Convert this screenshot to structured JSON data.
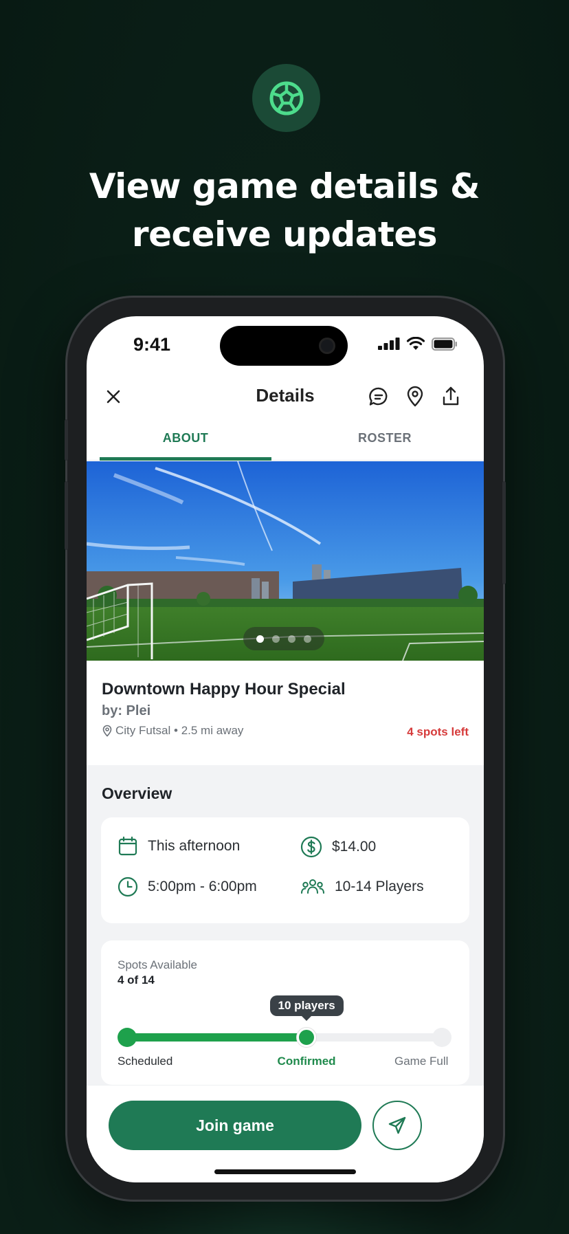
{
  "promo": {
    "headline_line1": "View game details &",
    "headline_line2": "receive updates",
    "badge_icon": "soccer-ball-icon"
  },
  "status_bar": {
    "time": "9:41"
  },
  "nav": {
    "title": "Details",
    "close_icon": "close-icon",
    "actions": [
      "chat-icon",
      "location-pin-icon",
      "share-icon"
    ]
  },
  "tabs": [
    {
      "label": "ABOUT",
      "active": true
    },
    {
      "label": "ROSTER",
      "active": false
    }
  ],
  "carousel": {
    "count": 4,
    "active_index": 0
  },
  "game": {
    "title": "Downtown Happy Hour Special",
    "organizer": "by: Plei",
    "location": "City Futsal • 2.5 mi away",
    "spots_left": "4 spots left"
  },
  "overview": {
    "title": "Overview",
    "date": "This afternoon",
    "price": "$14.00",
    "time": "5:00pm - 6:00pm",
    "players": "10-14 Players"
  },
  "spots": {
    "label": "Spots Available",
    "value": "4 of 14",
    "tooltip": "10 players",
    "progress": 0.57,
    "stages": [
      "Scheduled",
      "Confirmed",
      "Game Full"
    ]
  },
  "actions": {
    "join_label": "Join game",
    "send_icon": "send-icon"
  },
  "colors": {
    "brand_green": "#1f7a55",
    "progress_green": "#1ea14c",
    "alert_red": "#d63b3b",
    "background_dark": "#081a13"
  }
}
